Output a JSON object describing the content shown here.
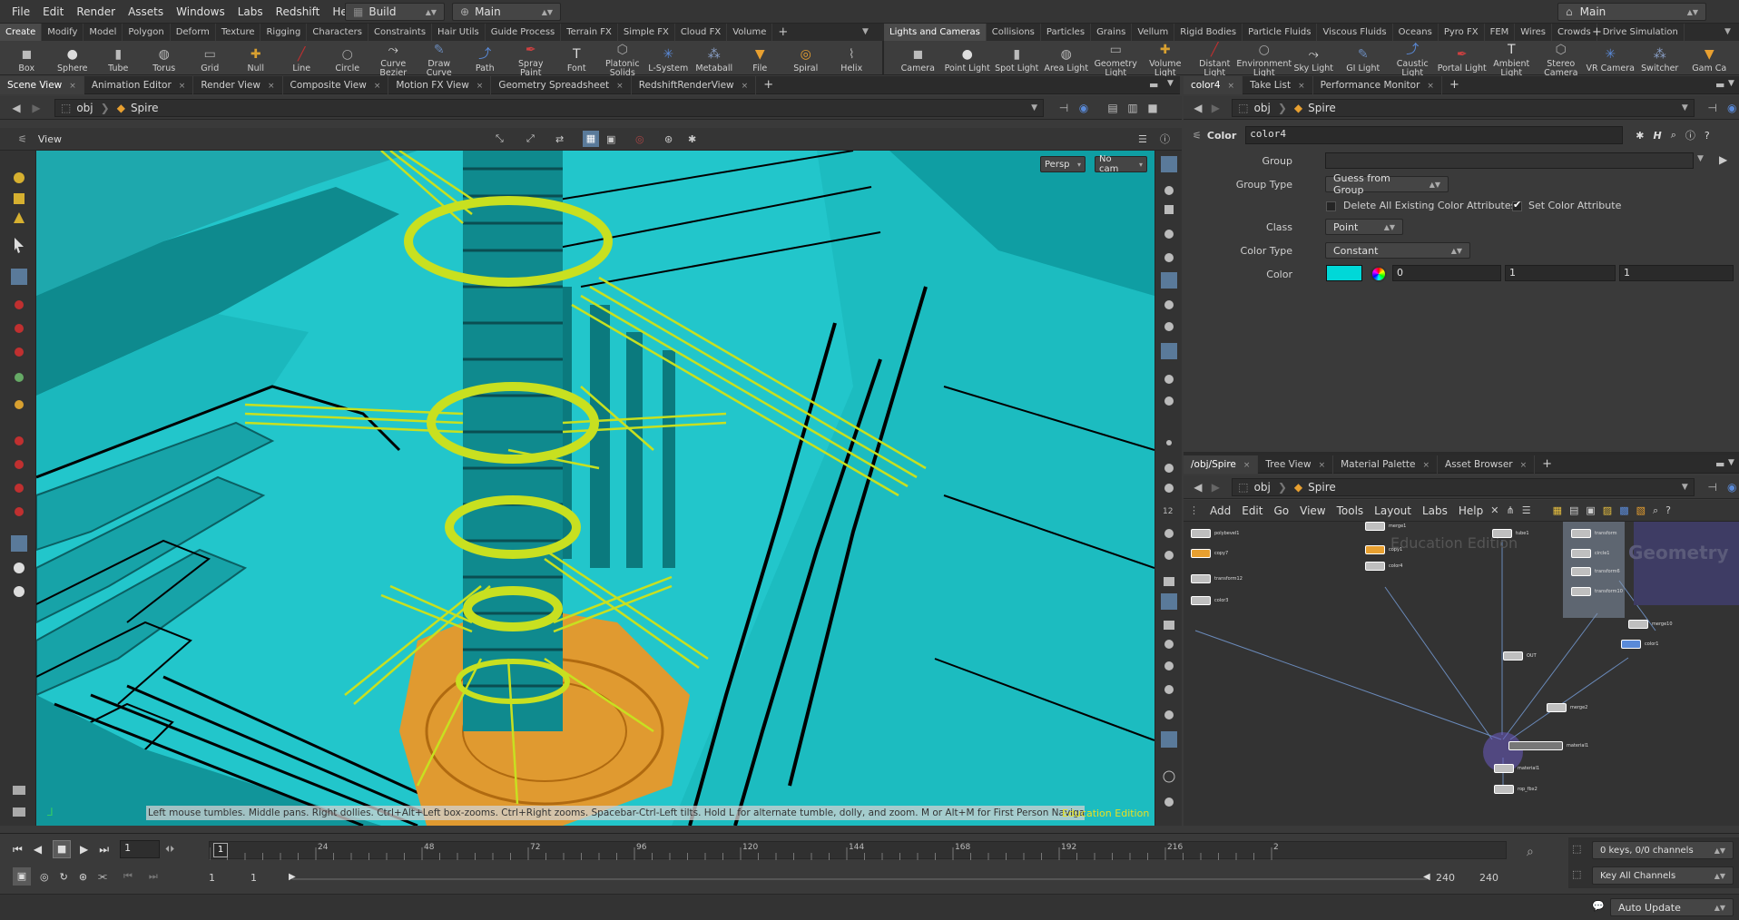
{
  "menu": [
    "File",
    "Edit",
    "Render",
    "Assets",
    "Windows",
    "Labs",
    "Redshift",
    "Help"
  ],
  "desktop": "Build",
  "takes": "Main",
  "topright": "Main",
  "shelf_tabs_left": [
    "Create",
    "Modify",
    "Model",
    "Polygon",
    "Deform",
    "Texture",
    "Rigging",
    "Characters",
    "Constraints",
    "Hair Utils",
    "Guide Process",
    "Terrain FX",
    "Simple FX",
    "Cloud FX",
    "Volume"
  ],
  "shelf_tabs_right": [
    "Lights and Cameras",
    "Collisions",
    "Particles",
    "Grains",
    "Vellum",
    "Rigid Bodies",
    "Particle Fluids",
    "Viscous Fluids",
    "Oceans",
    "Pyro FX",
    "FEM",
    "Wires",
    "Crowds",
    "Drive Simulation"
  ],
  "tools_left": [
    "Box",
    "Sphere",
    "Tube",
    "Torus",
    "Grid",
    "Null",
    "Line",
    "Circle",
    "Curve Bezier",
    "Draw Curve",
    "Path",
    "Spray Paint",
    "Font",
    "Platonic Solids",
    "L-System",
    "Metaball",
    "File",
    "Spiral",
    "Helix"
  ],
  "tools_right": [
    "Camera",
    "Point Light",
    "Spot Light",
    "Area Light",
    "Geometry Light",
    "Volume Light",
    "Distant Light",
    "Environment Light",
    "Sky Light",
    "GI Light",
    "Caustic Light",
    "Portal Light",
    "Ambient Light",
    "Stereo Camera",
    "VR Camera",
    "Switcher",
    "Gam Ca"
  ],
  "viewer_tabs": [
    "Scene View",
    "Animation Editor",
    "Render View",
    "Composite View",
    "Motion FX View",
    "Geometry Spreadsheet",
    "RedshiftRenderView"
  ],
  "param_tabs": [
    "color4",
    "Take List",
    "Performance Monitor"
  ],
  "network_tabs": [
    "/obj/Spire",
    "Tree View",
    "Material Palette",
    "Asset Browser"
  ],
  "path": {
    "root": "obj",
    "node": "Spire"
  },
  "viewport": {
    "title": "View",
    "persp": "Persp",
    "cam": "No cam",
    "status": "Left mouse tumbles. Middle pans. Right dollies. Ctrl+Alt+Left box-zooms. Ctrl+Right zooms. Spacebar-Ctrl-Left tilts. Hold L for alternate tumble, dolly, and zoom.     M or Alt+M for First Person Navigation.",
    "edition": "Education Edition"
  },
  "params": {
    "type": "Color",
    "name": "color4",
    "group_label": "Group",
    "group_value": "",
    "group_type_label": "Group Type",
    "group_type": "Guess from Group",
    "delete_label": "Delete All Existing Color Attributes",
    "set_label": "Set Color Attribute",
    "class_label": "Class",
    "class": "Point",
    "color_type_label": "Color Type",
    "color_type": "Constant",
    "color_label": "Color",
    "r": "0",
    "g": "1",
    "b": "1",
    "swatch": "#00d8d8"
  },
  "network": {
    "menus": [
      "Add",
      "Edit",
      "Go",
      "View",
      "Tools",
      "Layout",
      "Labs",
      "Help"
    ],
    "watermark": "Education Edition",
    "context": "Geometry",
    "nodes": [
      "polybevel1",
      "copy7",
      "transform12",
      "color3",
      "merge1",
      "copy1",
      "color4",
      "tube1",
      "transform",
      "circle1",
      "transform6",
      "transform10",
      "merge10",
      "color1",
      "material1",
      "OUT",
      "merge2",
      "material1",
      "rop_fbx2"
    ]
  },
  "timeline": {
    "ticks": [
      "24",
      "48",
      "72",
      "96",
      "120",
      "144",
      "168",
      "192",
      "216"
    ],
    "tick_last": "2",
    "frame": "1",
    "start": "1",
    "start2": "1",
    "end": "240",
    "end2": "240",
    "keys": "0 keys, 0/0 channels",
    "key_all": "Key All Channels",
    "auto_update": "Auto Update",
    "current_frame": "1"
  }
}
